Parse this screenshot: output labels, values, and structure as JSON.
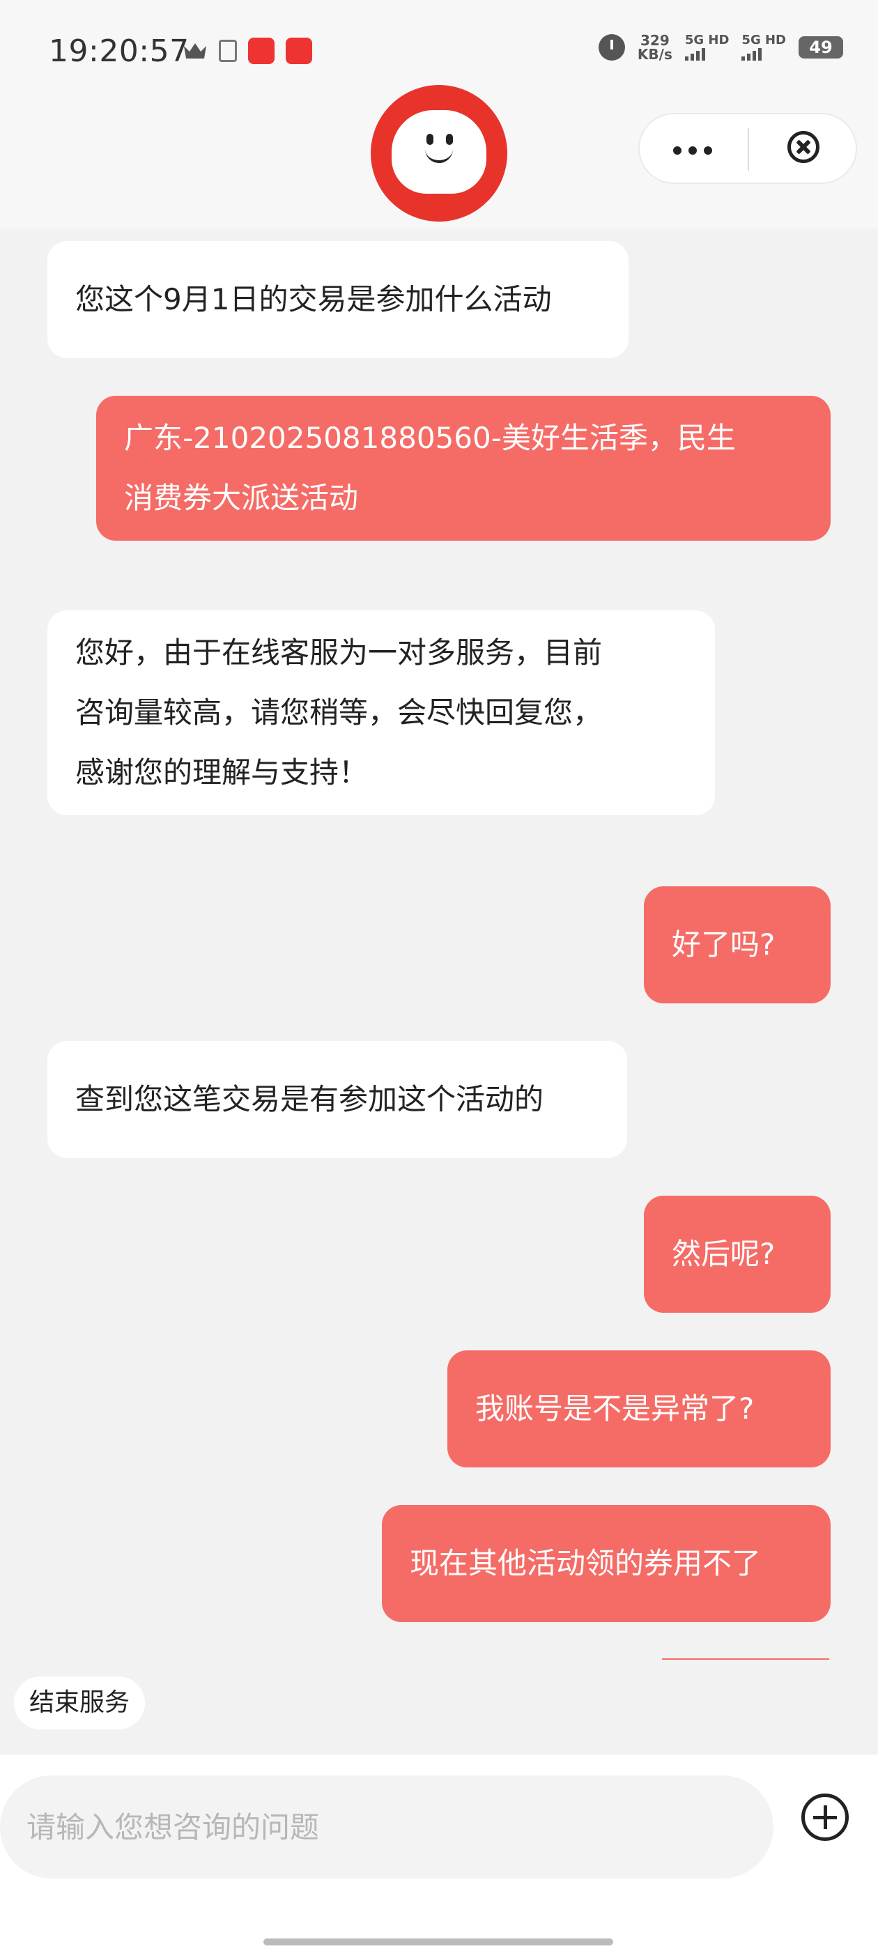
{
  "status_bar": {
    "time": "19:20:57",
    "speed_value": "329",
    "speed_unit": "KB/s",
    "sim1": "5G HD",
    "sim2": "5G HD",
    "battery": "49"
  },
  "header": {
    "more_icon": "more-horizontal-icon",
    "close_icon": "close-circle-icon"
  },
  "messages": [
    {
      "side": "in",
      "lines": [
        "您这个9月1日的交易是参加什么活动"
      ]
    },
    {
      "side": "out",
      "lines": [
        "广东-2102025081880560-美好生活季，民生",
        "消费券大派送活动"
      ]
    },
    {
      "side": "in",
      "lines": [
        "您好，由于在线客服为一对多服务，目前",
        "咨询量较高，请您稍等，会尽快回复您，",
        "感谢您的理解与支持！"
      ]
    },
    {
      "side": "out",
      "lines": [
        "好了吗?"
      ]
    },
    {
      "side": "in",
      "lines": [
        "查到您这笔交易是有参加这个活动的"
      ]
    },
    {
      "side": "out",
      "lines": [
        "然后呢?"
      ]
    },
    {
      "side": "out",
      "lines": [
        "我账号是不是异常了?"
      ]
    },
    {
      "side": "out",
      "lines": [
        "现在其他活动领的券用不了"
      ]
    }
  ],
  "end_service_label": "结束服务",
  "input": {
    "placeholder": "请输入您想咨询的问题"
  },
  "colors": {
    "outgoing_bubble": "#f56c67",
    "incoming_bubble": "#ffffff",
    "background": "#f2f2f2"
  }
}
